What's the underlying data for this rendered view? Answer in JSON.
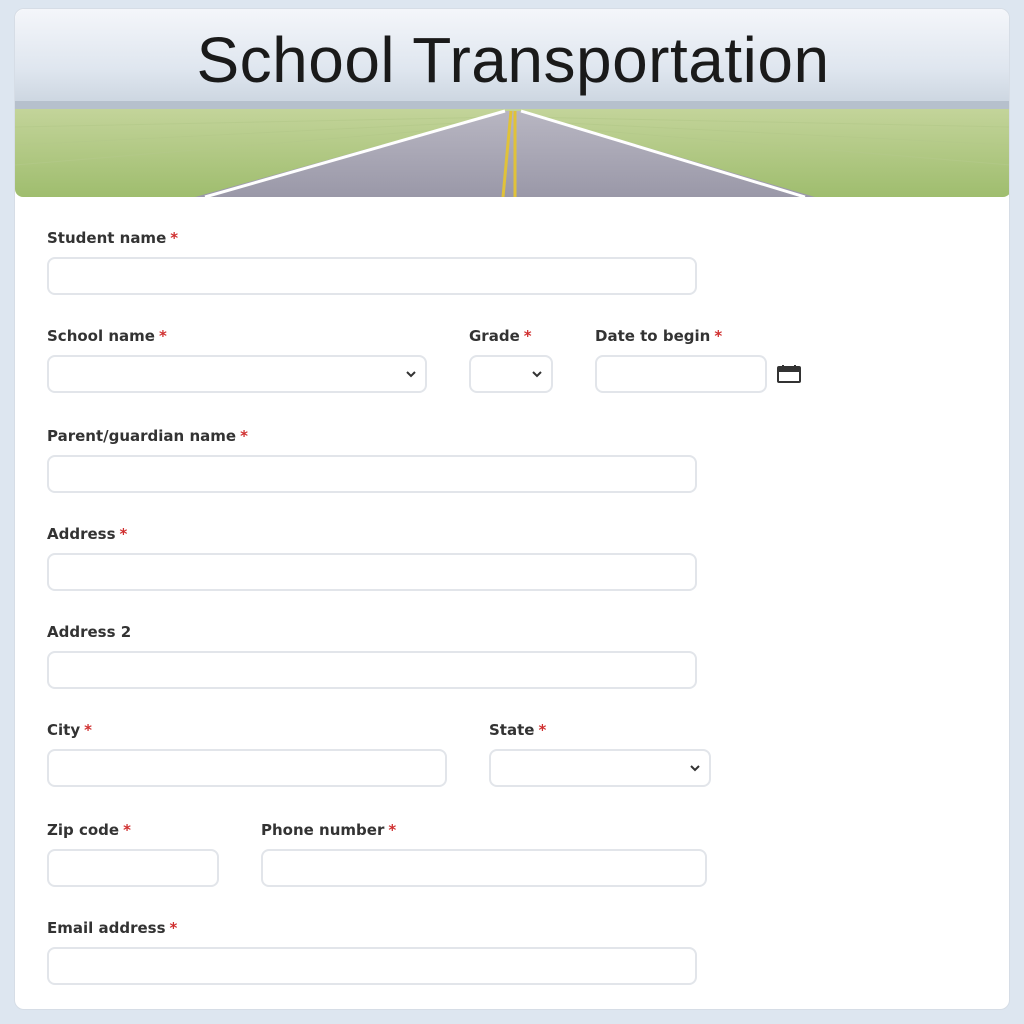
{
  "banner": {
    "title": "School Transportation"
  },
  "form": {
    "required_mark": "*",
    "student_name": {
      "label": "Student name",
      "value": ""
    },
    "school_name": {
      "label": "School name",
      "value": ""
    },
    "grade": {
      "label": "Grade",
      "value": ""
    },
    "date_to_begin": {
      "label": "Date to begin",
      "value": ""
    },
    "parent_name": {
      "label": "Parent/guardian name",
      "value": ""
    },
    "address": {
      "label": "Address",
      "value": ""
    },
    "address2": {
      "label": "Address 2",
      "value": ""
    },
    "city": {
      "label": "City",
      "value": ""
    },
    "state": {
      "label": "State",
      "value": ""
    },
    "zip": {
      "label": "Zip code",
      "value": ""
    },
    "phone": {
      "label": "Phone number",
      "value": ""
    },
    "email": {
      "label": "Email address",
      "value": ""
    }
  },
  "icons": {
    "select_arrow": "chevron-down-icon",
    "date_picker": "calendar-icon"
  },
  "colors": {
    "required": "#d03030",
    "field_border": "#e2e5ea",
    "page_bg": "#dde6f0"
  }
}
